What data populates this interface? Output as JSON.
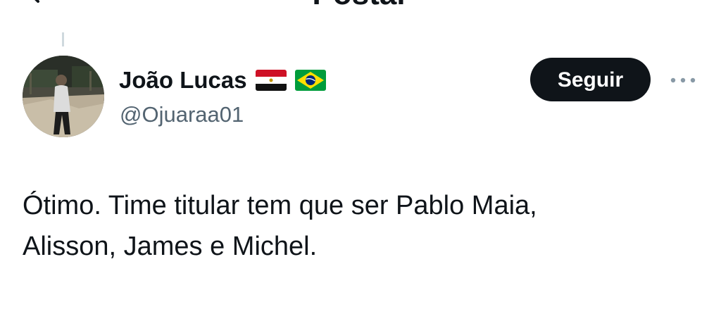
{
  "header": {
    "title": "Postar",
    "back_icon": "arrow-left-icon"
  },
  "post": {
    "author": {
      "display_name": "João Lucas",
      "handle": "@Ojuaraa01",
      "flags": [
        "egypt-flag",
        "brazil-flag"
      ],
      "avatar": "avatar-photo"
    },
    "follow_label": "Seguir",
    "more_icon": "more-options-icon",
    "text_line1": "Ótimo. Time titular tem que ser Pablo Maia,",
    "text_line2": "Alisson, James e Michel."
  },
  "colors": {
    "text_primary": "#0f1419",
    "text_secondary": "#536471",
    "button_bg": "#0f1419",
    "button_text": "#ffffff",
    "thread_line": "#cfd9de"
  }
}
